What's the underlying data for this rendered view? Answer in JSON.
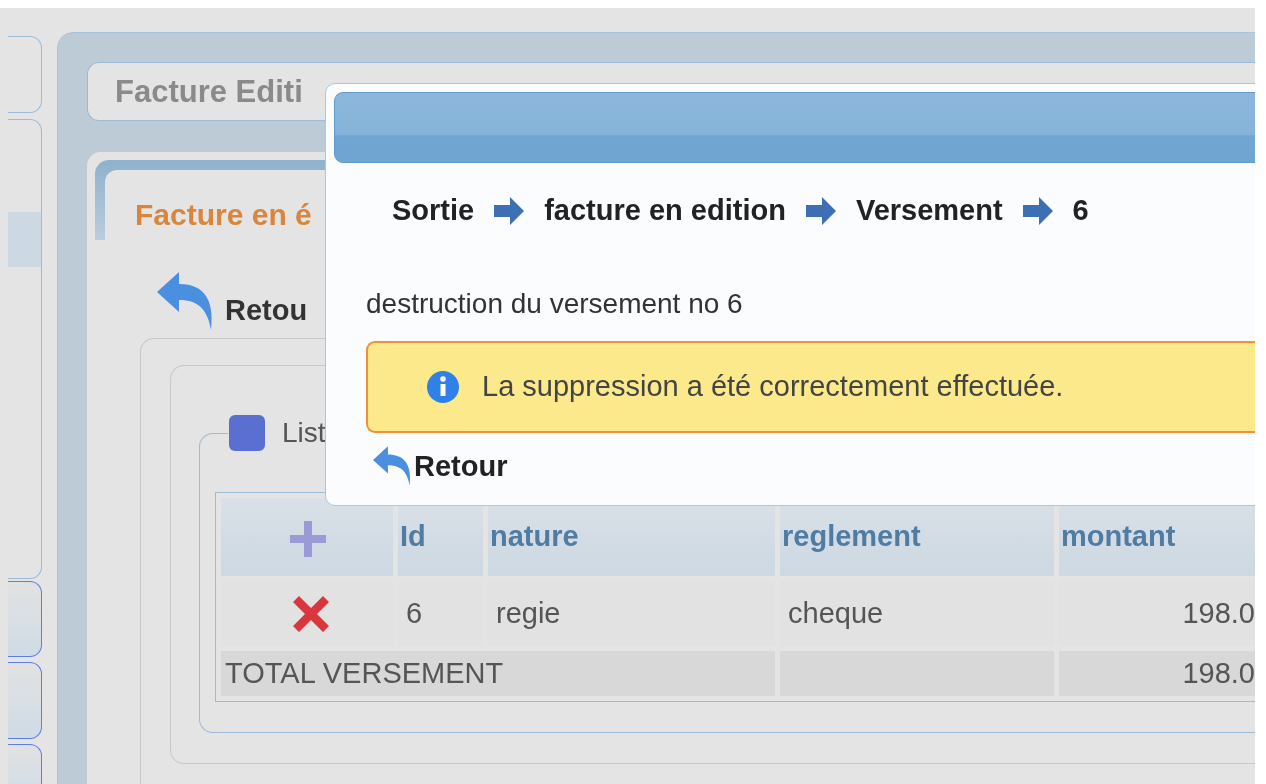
{
  "page_title": "Facture Editi",
  "tabs": [
    {
      "label": "Facture en é",
      "selected": true
    }
  ],
  "back_link": "Retou",
  "list_legend": "List",
  "table": {
    "columns": [
      "Id",
      "nature",
      "reglement",
      "montant"
    ],
    "rows": [
      {
        "kind": "item",
        "cells": [
          "6",
          "regie",
          "cheque",
          "198.0"
        ]
      }
    ],
    "total": {
      "label": "TOTAL VERSEMENT",
      "amount": "198.0"
    }
  },
  "dialog": {
    "breadcrumb": [
      "Sortie",
      "facture en edition",
      "Versement",
      "6"
    ],
    "message": "destruction du versement no 6",
    "alert": {
      "kind": "info",
      "text": "La suppression a été correctement effectuée."
    },
    "back_link": "Retour"
  }
}
